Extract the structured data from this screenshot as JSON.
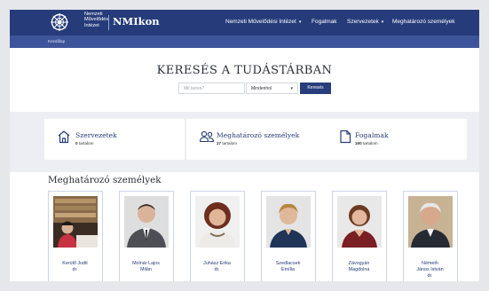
{
  "header": {
    "logo_lines": [
      "Nemzeti",
      "Művelődési",
      "Intézet"
    ],
    "brand": "NMIkon",
    "nav": [
      {
        "label": "Nemzeti Művelődési Intézet",
        "has_caret": true
      },
      {
        "label": "Fogalmak",
        "has_caret": false
      },
      {
        "label": "Szervezetek",
        "has_caret": true
      },
      {
        "label": "Meghatározó személyek",
        "has_caret": false
      }
    ],
    "breadcrumb": "Kezdőlap"
  },
  "search": {
    "title": "KERESÉS A TUDÁSTÁRBAN",
    "placeholder": "Mit keres?",
    "select_value": "Mindenhol",
    "button_label": "Keresés"
  },
  "categories": [
    {
      "title": "Szervezetek",
      "count": "0",
      "unit": "tartalom",
      "icon": "building-icon"
    },
    {
      "title": "Meghatározó személyek",
      "count": "27",
      "unit": "tartalom",
      "icon": "people-icon"
    },
    {
      "title": "Fogalmak",
      "count": "160",
      "unit": "tartalom",
      "icon": "document-icon"
    }
  ],
  "people_section": {
    "title": "Meghatározó személyek",
    "people": [
      {
        "line1": "Kerülő Judit",
        "line2": "dr."
      },
      {
        "line1": "Molnár Lajos",
        "line2": "Milán"
      },
      {
        "line1": "Juhász Erika",
        "line2": "dr."
      },
      {
        "line1": "Szedlacsek",
        "line2": "Emília"
      },
      {
        "line1": "Závogyán",
        "line2": "Magdolna"
      },
      {
        "line1": "Németh",
        "line2": "János István"
      },
      {
        "line1": "",
        "line2": "dr."
      }
    ]
  },
  "colors": {
    "navbar": "#263c7a",
    "subbar": "#3e549a",
    "button": "#273d7c",
    "band": "#eceef3"
  }
}
